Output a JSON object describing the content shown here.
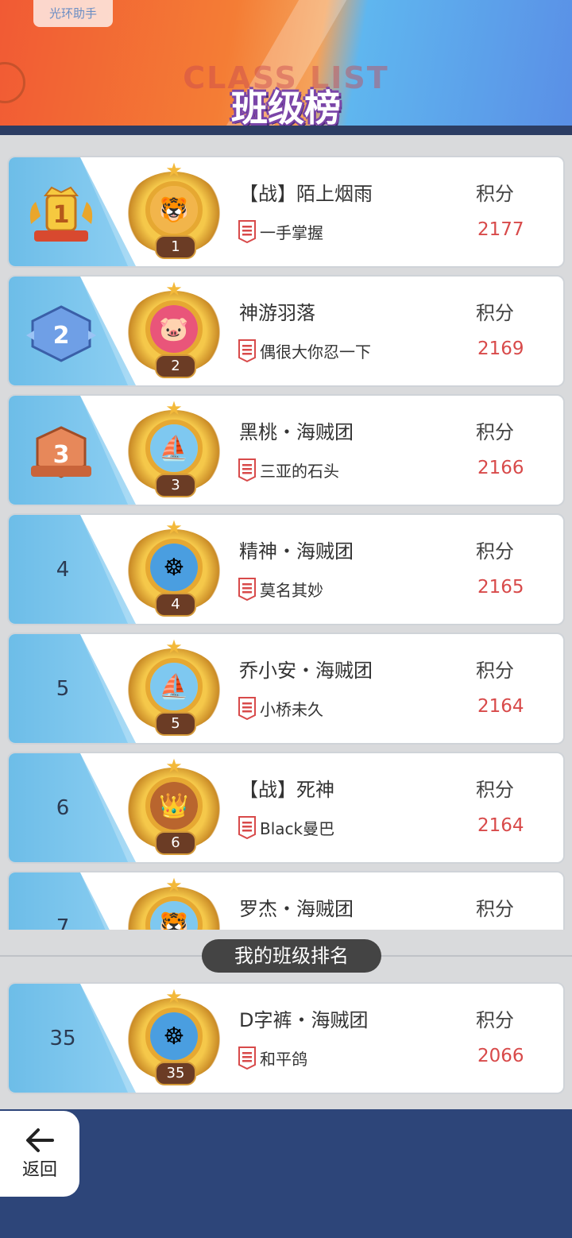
{
  "header": {
    "app_tag": "光环助手",
    "title_en": "CLASS LIST",
    "title_cn": "班级榜"
  },
  "list": [
    {
      "rank": "1",
      "team": "【战】陌上烟雨",
      "leader": "一手掌握",
      "score_label": "积分",
      "score": "2177",
      "medal": "tiger"
    },
    {
      "rank": "2",
      "team": "神游羽落",
      "leader": "偶很大你忍一下",
      "score_label": "积分",
      "score": "2169",
      "medal": "pig"
    },
    {
      "rank": "3",
      "team": "黑桃・海贼团",
      "leader": "三亚的石头",
      "score_label": "积分",
      "score": "2166",
      "medal": "ship"
    },
    {
      "rank": "4",
      "team": "精神・海贼团",
      "leader": "莫名其妙",
      "score_label": "积分",
      "score": "2165",
      "medal": "wheel"
    },
    {
      "rank": "5",
      "team": "乔小安・海贼团",
      "leader": "小桥未久",
      "score_label": "积分",
      "score": "2164",
      "medal": "ship"
    },
    {
      "rank": "6",
      "team": "【战】死神",
      "leader": "Black曼巴",
      "score_label": "积分",
      "score": "2164",
      "medal": "crown"
    },
    {
      "rank": "7",
      "team": "罗杰・海贼团",
      "leader": "",
      "score_label": "积分",
      "score": "",
      "medal": "tiger"
    }
  ],
  "my_rank": {
    "section_label": "我的班级排名",
    "rank": "35",
    "team": "D字裤・海贼团",
    "leader": "和平鸽",
    "score_label": "积分",
    "score": "2066"
  },
  "back_button": {
    "label": "返回"
  },
  "colors": {
    "score": "#d84a4a",
    "rank_stripe": "#6dbde8",
    "bottom_bg": "#2d4579"
  }
}
